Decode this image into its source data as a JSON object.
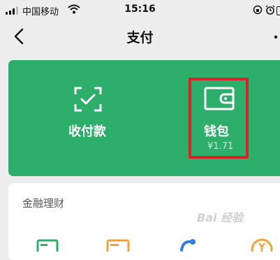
{
  "status_bar": {
    "carrier": "中国移动",
    "time": "15:16",
    "icons": [
      "signal-icon",
      "wifi-icon",
      "screen-lock-icon",
      "alarm-icon",
      "battery-icon"
    ]
  },
  "nav": {
    "title": "支付",
    "back_icon": "chevron-left-icon",
    "more_icon": "more-dots-icon"
  },
  "pay_card": {
    "color": "#2dae6a",
    "receive_pay": {
      "label": "收付款",
      "icon": "qr-scan-icon"
    },
    "wallet": {
      "label": "钱包",
      "balance": "¥1.71",
      "icon": "wallet-icon"
    },
    "highlight_color": "#d8232a"
  },
  "finance": {
    "title": "金融理财",
    "icons": [
      "credit-card-icon",
      "loan-icon",
      "wealth-icon",
      "fund-icon"
    ]
  },
  "watermark": "Bai 经验"
}
